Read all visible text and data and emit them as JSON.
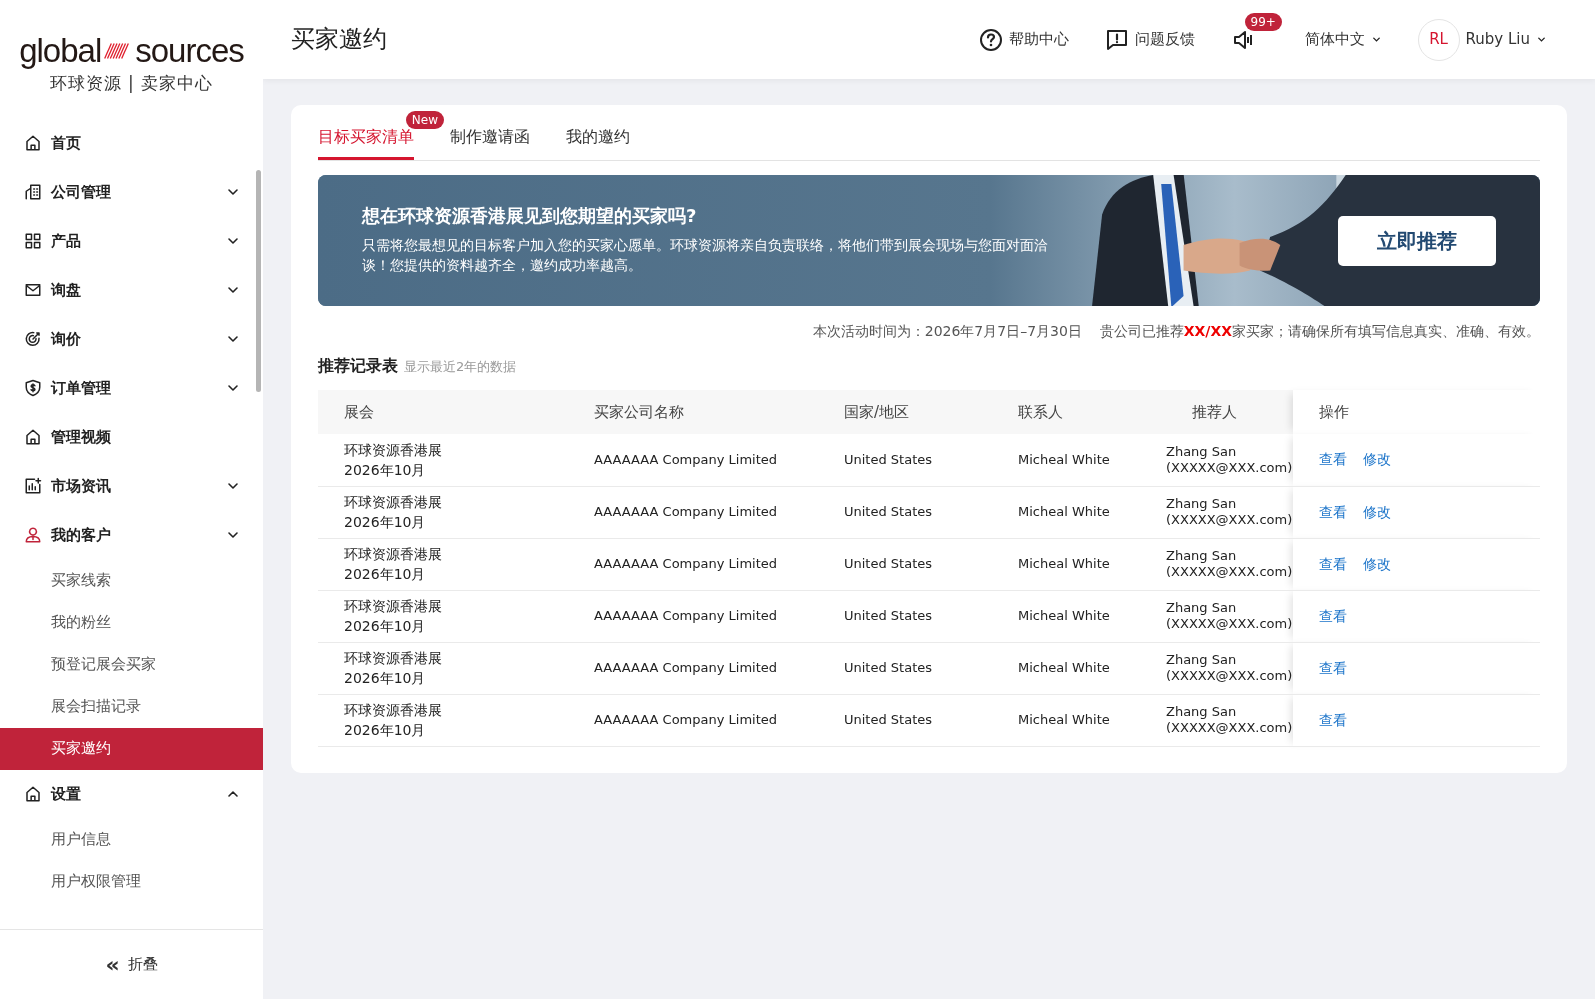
{
  "sidebar": {
    "logo": {
      "word_left": "global",
      "word_right": "sources",
      "subtitle": "环球资源 | 卖家中心"
    },
    "items": [
      {
        "label": "首页",
        "active": false
      },
      {
        "label": "公司管理",
        "expanded": false,
        "active": false
      },
      {
        "label": "产品",
        "expanded": false,
        "active": false
      },
      {
        "label": "询盘",
        "expanded": false,
        "active": false
      },
      {
        "label": "询价",
        "expanded": false,
        "active": false
      },
      {
        "label": "订单管理",
        "expanded": false,
        "active": false
      },
      {
        "label": "管理视频",
        "active": false
      },
      {
        "label": "市场资讯",
        "expanded": false,
        "active": false
      },
      {
        "label": "我的客户",
        "expanded": false,
        "active": true,
        "children": [
          {
            "label": "买家线索",
            "selected": false
          },
          {
            "label": "我的粉丝",
            "selected": false
          },
          {
            "label": "预登记展会买家",
            "selected": false
          },
          {
            "label": "展会扫描记录",
            "selected": false
          },
          {
            "label": "买家邀约",
            "selected": true
          }
        ]
      },
      {
        "label": "设置",
        "expanded": true,
        "active": false,
        "children": [
          {
            "label": "用户信息",
            "selected": false
          },
          {
            "label": "用户权限管理",
            "selected": false
          }
        ]
      }
    ],
    "collapse": {
      "icon": "«",
      "label": "折叠"
    }
  },
  "header": {
    "title": "买家邀约",
    "actions": [
      {
        "kind": "help",
        "label": "帮助中心"
      },
      {
        "kind": "feedback",
        "label": "问题反馈"
      },
      {
        "kind": "notice",
        "badge": "99+"
      },
      {
        "kind": "language",
        "label": "简体中文"
      },
      {
        "kind": "user",
        "initials": "RL",
        "label": "Ruby Liu"
      }
    ]
  },
  "tabs": [
    {
      "label": "目标买家清单",
      "selected": true,
      "badge": "New"
    },
    {
      "label": "制作邀请函",
      "selected": false
    },
    {
      "label": "我的邀约",
      "selected": false
    }
  ],
  "banner": {
    "title": "想在环球资源香港展见到您期望的买家吗?",
    "text": "只需将您最想见的目标客户加入您的买家心愿单。环球资源将亲自负责联络，将他们带到展会现场与您面对面洽谈！您提供的资料越齐全，邀约成功率越高。",
    "button": "立即推荐",
    "kind": "picture"
  },
  "notice": {
    "before": "本次活动时间为：2026年7月7日–7月30日    贵公司已推荐",
    "highlight": "XX/XX",
    "after": "家买家；请确保所有填写信息真实、准确、有效。"
  },
  "records": {
    "title": "推荐记录表",
    "hint": "显示最近2年的数据",
    "columns": [
      "展会",
      "买家公司名称",
      "国家/地区",
      "联系人",
      "推荐人",
      "操作"
    ],
    "rows": [
      {
        "fair": [
          "环球资源香港展",
          "2026年10月"
        ],
        "company": "AAAAAAA Company Limited",
        "country": "United States",
        "contact": "Micheal White",
        "referrer": [
          "Zhang San",
          "(XXXXX@XXX.com)"
        ],
        "actions": [
          "查看",
          "修改"
        ]
      },
      {
        "fair": [
          "环球资源香港展",
          "2026年10月"
        ],
        "company": "AAAAAAA Company Limited",
        "country": "United States",
        "contact": "Micheal White",
        "referrer": [
          "Zhang San",
          "(XXXXX@XXX.com)"
        ],
        "actions": [
          "查看",
          "修改"
        ]
      },
      {
        "fair": [
          "环球资源香港展",
          "2026年10月"
        ],
        "company": "AAAAAAA Company Limited",
        "country": "United States",
        "contact": "Micheal White",
        "referrer": [
          "Zhang San",
          "(XXXXX@XXX.com)"
        ],
        "actions": [
          "查看",
          "修改"
        ]
      },
      {
        "fair": [
          "环球资源香港展",
          "2026年10月"
        ],
        "company": "AAAAAAA Company Limited",
        "country": "United States",
        "contact": "Micheal White",
        "referrer": [
          "Zhang San",
          "(XXXXX@XXX.com)"
        ],
        "actions": [
          "查看"
        ]
      },
      {
        "fair": [
          "环球资源香港展",
          "2026年10月"
        ],
        "company": "AAAAAAA Company Limited",
        "country": "United States",
        "contact": "Micheal White",
        "referrer": [
          "Zhang San",
          "(XXXXX@XXX.com)"
        ],
        "actions": [
          "查看"
        ]
      },
      {
        "fair": [
          "环球资源香港展",
          "2026年10月"
        ],
        "company": "AAAAAAA Company Limited",
        "country": "United States",
        "contact": "Micheal White",
        "referrer": [
          "Zhang San",
          "(XXXXX@XXX.com)"
        ],
        "actions": [
          "查看"
        ]
      }
    ]
  }
}
